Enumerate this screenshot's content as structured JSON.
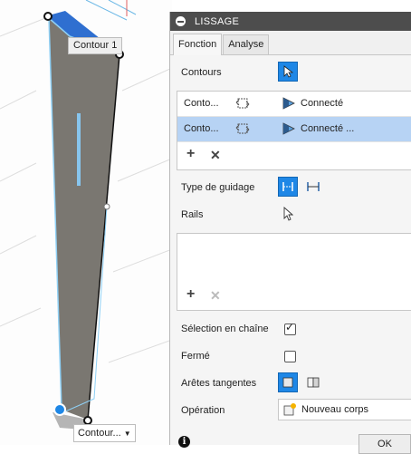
{
  "viewport": {
    "contour_tag_top": "Contour 1",
    "contour_tag_bottom": "Contour...",
    "colors": {
      "body": "#7a7771",
      "edge": "#6cb8e6",
      "face_blue": "#2f6fd0"
    }
  },
  "dialog": {
    "title": "LISSAGE",
    "tabs": [
      "Fonction",
      "Analyse"
    ],
    "active_tab": "Fonction",
    "contours_label": "Contours",
    "contours_list": [
      {
        "name": "Conto...",
        "status": "Connecté",
        "selected": false
      },
      {
        "name": "Conto...",
        "status": "Connecté ...",
        "selected": true
      }
    ],
    "guidage_label": "Type de guidage",
    "rails_label": "Rails",
    "chain_label": "Sélection en chaîne",
    "chain_checked": true,
    "closed_label": "Fermé",
    "closed_checked": false,
    "tangent_label": "Arêtes tangentes",
    "operation_label": "Opération",
    "operation_value": "Nouveau corps",
    "ok_label": "OK",
    "icons": {
      "close": "minus-circle-icon",
      "select": "cursor-arrow-icon",
      "add": "plus-icon",
      "remove": "x-icon",
      "info": "info-icon"
    },
    "accent_color": "#1e87e6",
    "selected_row_color": "#b7d3f4"
  }
}
